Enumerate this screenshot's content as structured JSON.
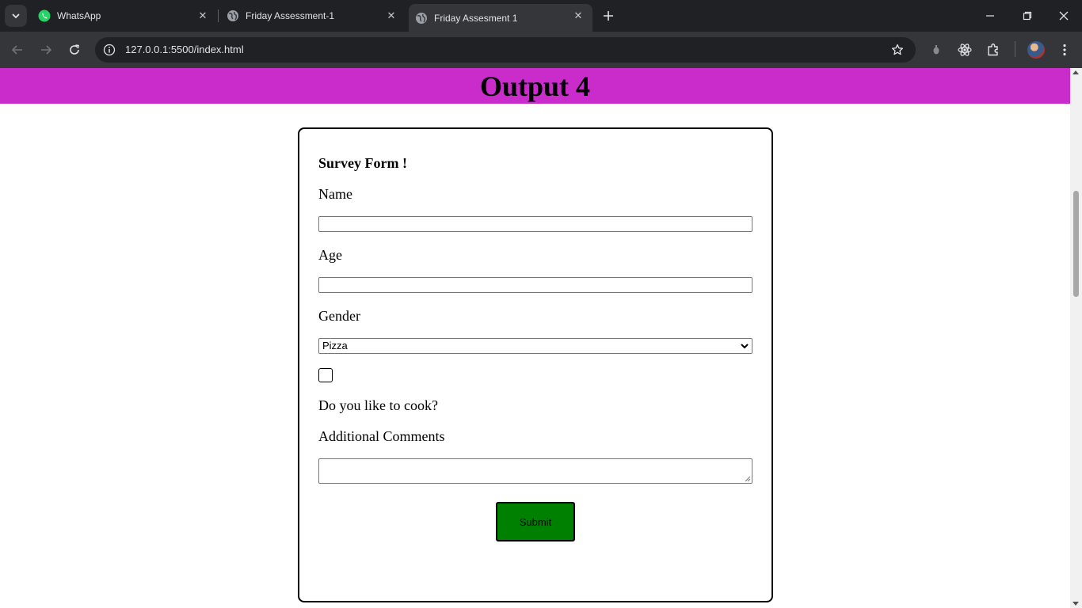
{
  "browser": {
    "tabs": [
      {
        "title": "WhatsApp",
        "icon": "whatsapp-icon",
        "active": false
      },
      {
        "title": "Friday Assessment-1",
        "icon": "globe-icon",
        "active": false
      },
      {
        "title": "Friday Assesment 1",
        "icon": "globe-icon",
        "active": true
      }
    ],
    "url": "127.0.0.1:5500/index.html"
  },
  "page": {
    "banner_title": "Output 4",
    "banner_color": "#c92ccb",
    "form": {
      "title": "Survey Form !",
      "name_label": "Name",
      "age_label": "Age",
      "gender_label": "Gender",
      "gender_selected": "Pizza",
      "cook_label": "Do you like to cook?",
      "comments_label": "Additional Comments",
      "submit_label": "Submit",
      "submit_color": "#008000"
    }
  }
}
